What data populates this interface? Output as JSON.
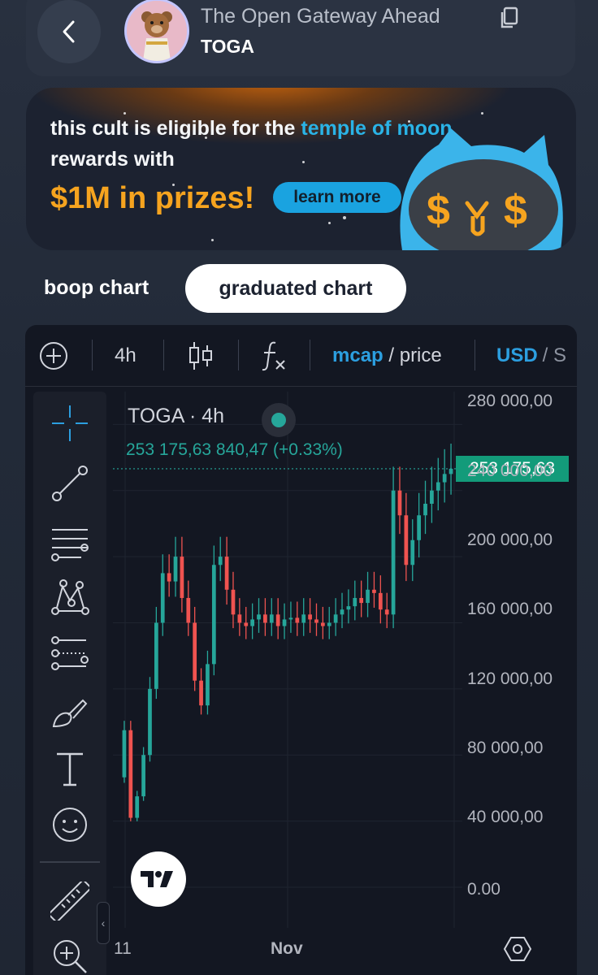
{
  "header": {
    "coin_name": "The Open Gateway Ahead",
    "ticker": "TOGA"
  },
  "banner": {
    "line1_prefix": "this cult is eligible for the ",
    "line1_highlight": "temple of moon",
    "line2": "rewards with",
    "prize": "$1M in prizes!",
    "cta": "learn more"
  },
  "tabs": {
    "boop": "boop chart",
    "graduated": "graduated chart"
  },
  "toolbar": {
    "interval": "4h",
    "mcap": "mcap",
    "separator": " / ",
    "price": "price",
    "currency": "USD",
    "currency_alt": "/ S"
  },
  "legend": {
    "symbol": "TOGA · 4h",
    "values": "253 175,63  840,47 (+0.33%)"
  },
  "price_tag": "253 175,63",
  "axis": {
    "y_ticks": [
      "280 000,00",
      "240 000,00",
      "200 000,00",
      "160 000,00",
      "120 000,00",
      "80 000,00",
      "40 000,00",
      "0.00"
    ],
    "x_ticks": [
      "11",
      "Nov"
    ]
  },
  "colors": {
    "up": "#26a69a",
    "down": "#ef5350",
    "accent_blue": "#2c9fe0",
    "prize_orange": "#f6a41f"
  },
  "chart_data": {
    "type": "candlestick",
    "title": "TOGA · 4h",
    "last_value": 253175.63,
    "change": 840.47,
    "change_pct": 0.33,
    "ylim": [
      0,
      290000
    ],
    "x_tick_labels": [
      "11",
      "Nov"
    ],
    "series_approx_close": [
      95000,
      42000,
      55000,
      80000,
      120000,
      160000,
      190000,
      185000,
      200000,
      175000,
      160000,
      125000,
      110000,
      135000,
      195000,
      200000,
      180000,
      165000,
      160000,
      158000,
      162000,
      165000,
      160000,
      165000,
      158000,
      162000,
      163000,
      160000,
      165000,
      162000,
      160000,
      158000,
      160000,
      165000,
      168000,
      170000,
      175000,
      172000,
      180000,
      178000,
      168000,
      165000,
      240000,
      225000,
      195000,
      210000,
      225000,
      232000,
      240000,
      245000,
      250000,
      253175.63
    ]
  }
}
